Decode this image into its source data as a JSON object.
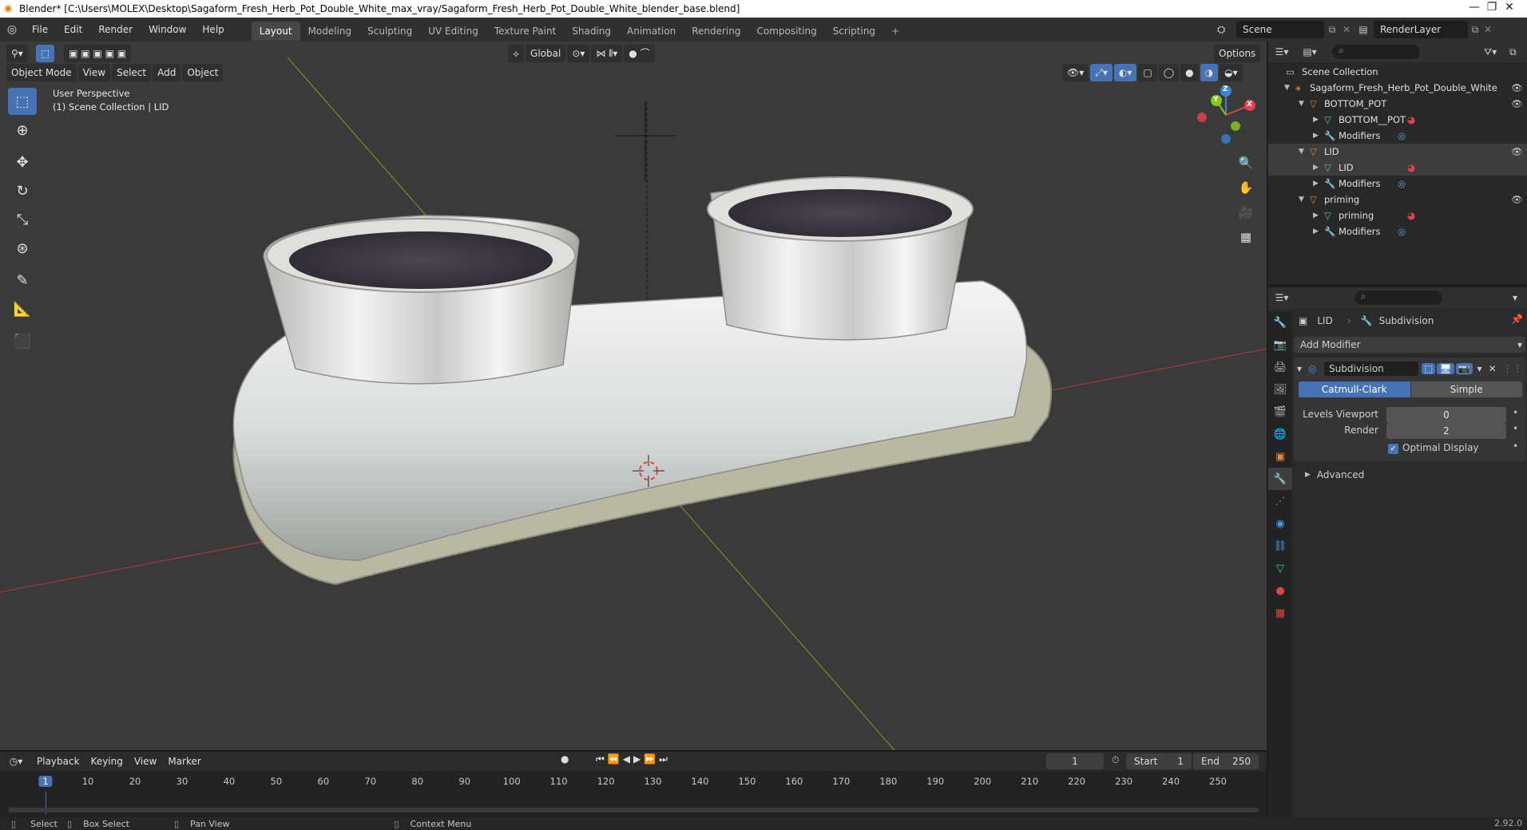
{
  "window": {
    "title": "Blender* [C:\\Users\\MOLEX\\Desktop\\Sagaform_Fresh_Herb_Pot_Double_White_max_vray/Sagaform_Fresh_Herb_Pot_Double_White_blender_base.blend]"
  },
  "menubar": {
    "menus": [
      "File",
      "Edit",
      "Render",
      "Window",
      "Help"
    ],
    "workspaces": [
      "Layout",
      "Modeling",
      "Sculpting",
      "UV Editing",
      "Texture Paint",
      "Shading",
      "Animation",
      "Rendering",
      "Compositing",
      "Scripting"
    ],
    "active_workspace": "Layout",
    "scene": "Scene",
    "render_layer": "RenderLayer"
  },
  "viewport": {
    "mode": "Object Mode",
    "menus": [
      "View",
      "Select",
      "Add",
      "Object"
    ],
    "transform_orientation": "Global",
    "options_label": "Options",
    "overlay_line1": "User Perspective",
    "overlay_line2": "(1) Scene Collection | LID",
    "gizmo_axes": {
      "x": "X",
      "y": "Y",
      "z": "Z"
    }
  },
  "timeline": {
    "menus": [
      "Playback",
      "Keying",
      "View",
      "Marker"
    ],
    "current_frame": "1",
    "start_label": "Start",
    "start_value": "1",
    "end_label": "End",
    "end_value": "250",
    "ruler": [
      "1",
      "10",
      "20",
      "30",
      "40",
      "50",
      "60",
      "70",
      "80",
      "90",
      "100",
      "110",
      "120",
      "130",
      "140",
      "150",
      "160",
      "170",
      "180",
      "190",
      "200",
      "210",
      "220",
      "230",
      "240",
      "250"
    ]
  },
  "statusbar": {
    "select": "Select",
    "box_select": "Box Select",
    "pan_view": "Pan View",
    "context_menu": "Context Menu",
    "version": "2.92.0"
  },
  "outliner": {
    "root": "Scene Collection",
    "rows": [
      {
        "label": "Sagaform_Fresh_Herb_Pot_Double_White",
        "type": "armature"
      },
      {
        "label": "BOTTOM_POT",
        "type": "object"
      },
      {
        "label": "BOTTOM__POT",
        "type": "mesh"
      },
      {
        "label": "Modifiers",
        "type": "modifiers"
      },
      {
        "label": "LID",
        "type": "object"
      },
      {
        "label": "LID",
        "type": "mesh"
      },
      {
        "label": "Modifiers",
        "type": "modifiers"
      },
      {
        "label": "priming",
        "type": "object"
      },
      {
        "label": "priming",
        "type": "mesh"
      },
      {
        "label": "Modifiers",
        "type": "modifiers"
      }
    ]
  },
  "properties": {
    "breadcrumb_object": "LID",
    "breadcrumb_modifier": "Subdivision",
    "add_modifier": "Add Modifier",
    "modifier_name": "Subdivision",
    "catmull_clark": "Catmull-Clark",
    "simple": "Simple",
    "levels_viewport_label": "Levels Viewport",
    "levels_viewport_value": "0",
    "render_label": "Render",
    "render_value": "2",
    "optimal_display": "Optimal Display",
    "advanced": "Advanced"
  },
  "colors": {
    "accent": "#4772b3",
    "axis_x": "#e0424f",
    "axis_y": "#85c71f",
    "axis_z": "#3c82d9",
    "object_orange": "#e8883b",
    "mesh_green": "#5fc4a0"
  }
}
